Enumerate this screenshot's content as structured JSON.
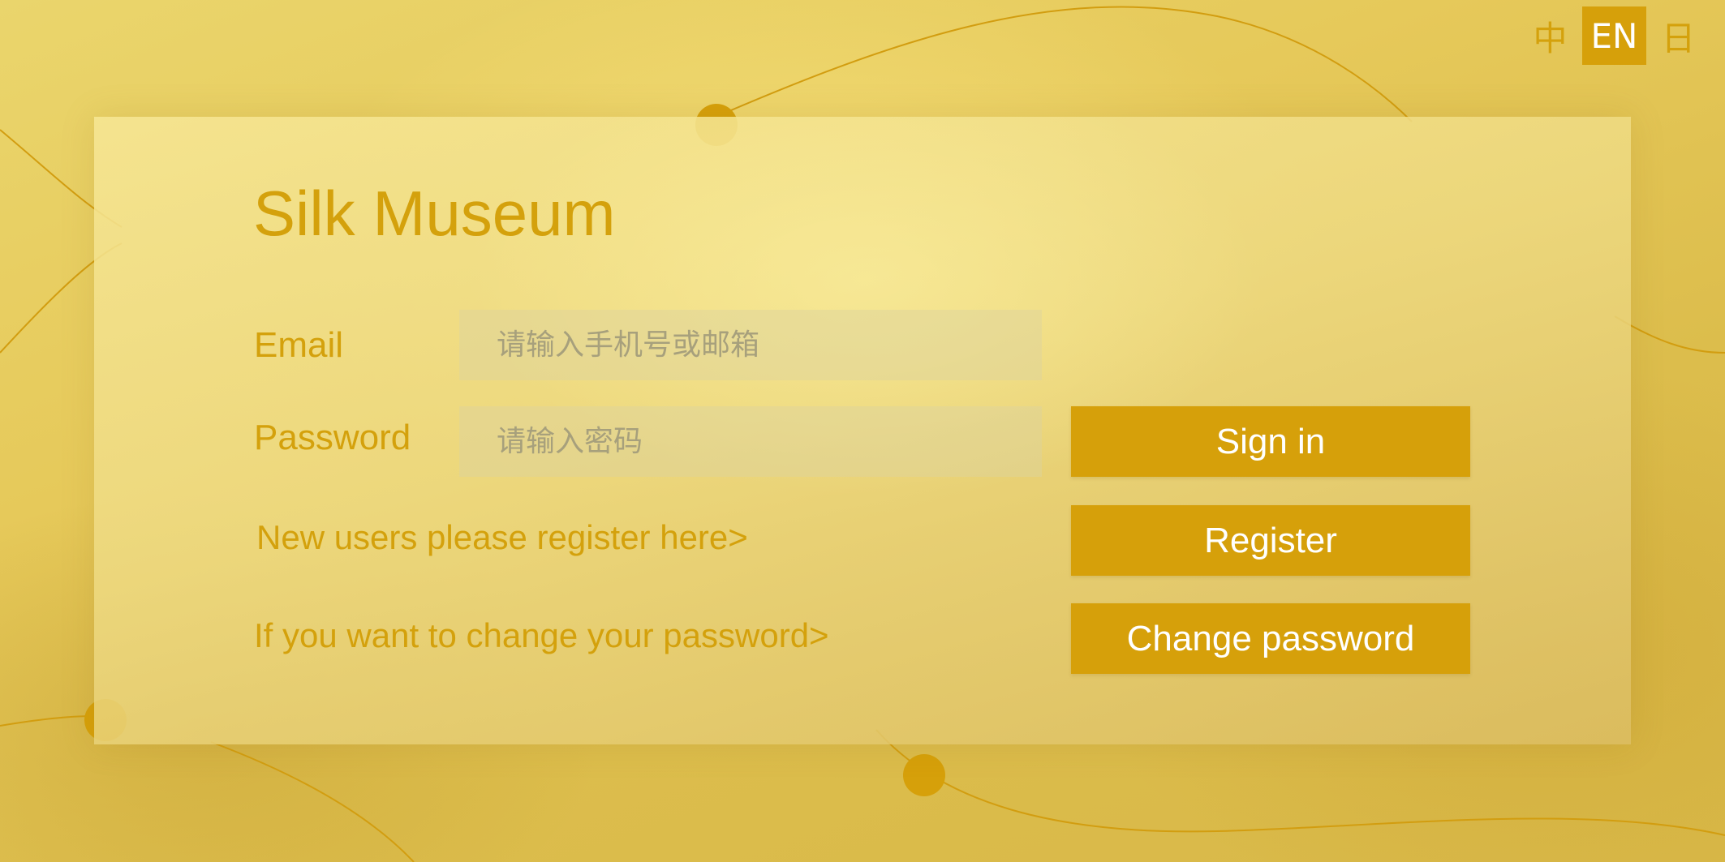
{
  "language_switch": {
    "options": [
      {
        "label": "中",
        "active": false
      },
      {
        "label": "EN",
        "active": true
      },
      {
        "label": "日",
        "active": false
      }
    ]
  },
  "login": {
    "title": "Silk Museum",
    "email_label": "Email",
    "email_placeholder": "请输入手机号或邮箱",
    "email_value": "",
    "password_label": "Password",
    "password_placeholder": "请输入密码",
    "password_value": "",
    "register_link": "New users please register here>",
    "change_password_link": "If you want to change your password>",
    "sign_in_button": "Sign in",
    "register_button": "Register",
    "change_password_button": "Change password"
  },
  "colors": {
    "accent": "#d6a00a",
    "text_gold": "#d4a10c",
    "button_text": "#ffffff"
  }
}
